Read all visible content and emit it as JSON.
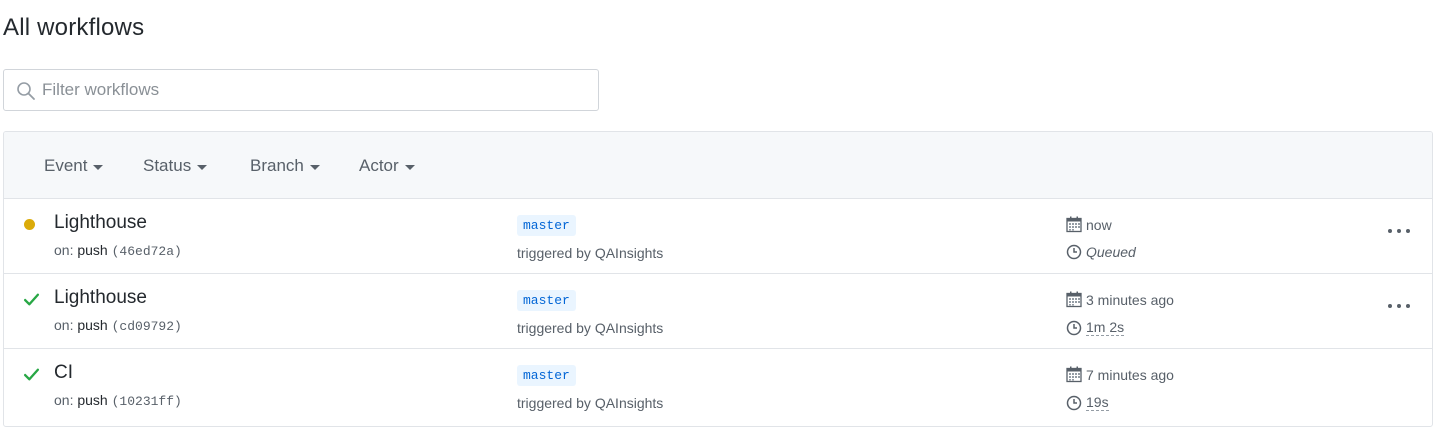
{
  "page": {
    "title": "All workflows"
  },
  "search": {
    "placeholder": "Filter workflows",
    "value": ""
  },
  "filters": {
    "event_label": "Event",
    "status_label": "Status",
    "branch_label": "Branch",
    "actor_label": "Actor"
  },
  "colors": {
    "queued": "#dbab09",
    "success": "#28a745"
  },
  "runs": [
    {
      "name": "Lighthouse",
      "status": "queued",
      "status_icon": "queued-dot-icon",
      "on_label": "on:",
      "event": "push",
      "sha": "(46ed72a)",
      "branch": "master",
      "triggered_by": "triggered by QAInsights",
      "time": "now",
      "duration": "Queued",
      "show_more": true
    },
    {
      "name": "Lighthouse",
      "status": "success",
      "status_icon": "check-icon",
      "on_label": "on:",
      "event": "push",
      "sha": "(cd09792)",
      "branch": "master",
      "triggered_by": "triggered by QAInsights",
      "time": "3 minutes ago",
      "duration": "1m 2s",
      "show_more": true
    },
    {
      "name": "CI",
      "status": "success",
      "status_icon": "check-icon",
      "on_label": "on:",
      "event": "push",
      "sha": "(10231ff)",
      "branch": "master",
      "triggered_by": "triggered by QAInsights",
      "time": "7 minutes ago",
      "duration": "19s",
      "show_more": false
    }
  ]
}
